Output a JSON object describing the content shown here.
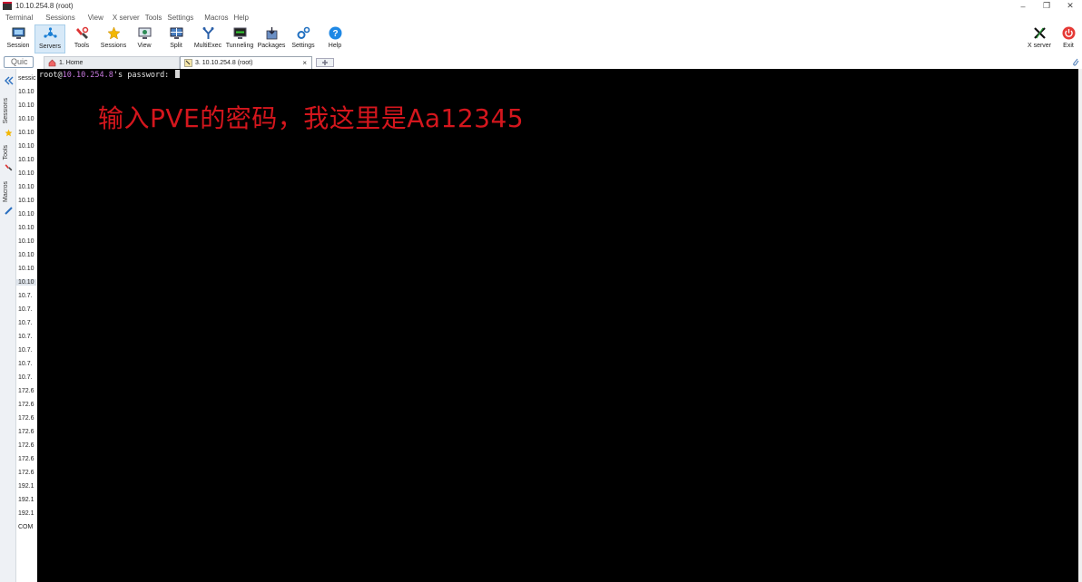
{
  "window": {
    "title": "10.10.254.8 (root)"
  },
  "menubar": {
    "items": [
      "Terminal",
      "Sessions",
      "View",
      "X server",
      "Tools",
      "Settings",
      "Macros",
      "Help"
    ]
  },
  "toolbar": {
    "buttons": [
      {
        "label": "Session",
        "icon": "monitor-icon"
      },
      {
        "label": "Servers",
        "icon": "network-icon",
        "active": true
      },
      {
        "label": "Tools",
        "icon": "tools-icon"
      },
      {
        "label": "Sessions",
        "icon": "star-icon"
      },
      {
        "label": "View",
        "icon": "view-icon"
      },
      {
        "label": "Split",
        "icon": "split-icon"
      },
      {
        "label": "MultiExec",
        "icon": "multiexec-icon"
      },
      {
        "label": "Tunneling",
        "icon": "tunneling-icon"
      },
      {
        "label": "Packages",
        "icon": "packages-icon"
      },
      {
        "label": "Settings",
        "icon": "gears-icon"
      },
      {
        "label": "Help",
        "icon": "help-icon"
      }
    ],
    "xserver_label": "X server",
    "exit_label": "Exit"
  },
  "quick_connect": {
    "value": "Quic"
  },
  "tabs": {
    "home": "1. Home",
    "ssh": "3. 10.10.254.8 (root)",
    "close": "×"
  },
  "side_strip": {
    "sessions": "Sessions",
    "tools": "Tools",
    "macros": "Macros"
  },
  "session_list": {
    "header": "sessic",
    "rows": [
      "10.10",
      "10.10",
      "10.10",
      "10.10",
      "10.10",
      "10.10",
      "10.10",
      "10.10",
      "10.10",
      "10.10",
      "10.10",
      "10.10",
      "10.10",
      "10.10",
      "10.10",
      "10.7.",
      "10.7.",
      "10.7.",
      "10.7.",
      "10.7.",
      "10.7.",
      "10.7.",
      "172.6",
      "172.6",
      "172.6",
      "172.6",
      "172.6",
      "172.6",
      "172.6",
      "192.1",
      "192.1",
      "192.1",
      "COM"
    ],
    "selected_index": 14
  },
  "terminal": {
    "prompt_user": "root@",
    "prompt_host": "10.10.254.8",
    "prompt_suffix": "'s password: ",
    "overlay": "输入PVE的密码，我这里是Aa12345"
  },
  "colors": {
    "overlay": "#d4161d",
    "host": "#c678dd",
    "terminal_bg": "#000000"
  }
}
